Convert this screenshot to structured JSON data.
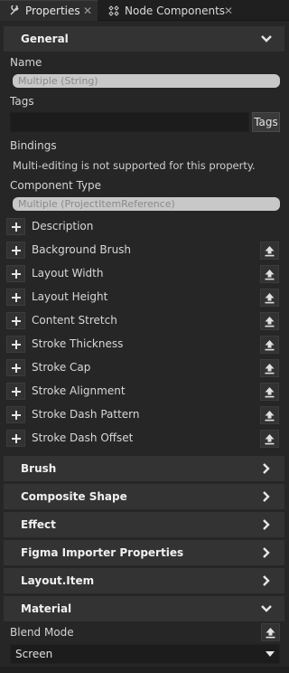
{
  "tabs": [
    {
      "label": "Properties",
      "close": "✕",
      "active": true,
      "icon": "wrench-icon"
    },
    {
      "label": "Node Components",
      "close": "✕",
      "active": false,
      "icon": "components-icon"
    }
  ],
  "general": {
    "header": "General",
    "name_label": "Name",
    "name_value": "Multiple (String)",
    "tags_label": "Tags",
    "tags_value": "",
    "tags_button": "Tags",
    "bindings_label": "Bindings",
    "bindings_note": "Multi-editing is not supported for this property.",
    "component_type_label": "Component Type",
    "component_type_value": "Multiple (ProjectItemReference)"
  },
  "properties": [
    {
      "label": "Description",
      "has_reset": false
    },
    {
      "label": "Background Brush",
      "has_reset": true
    },
    {
      "label": "Layout Width",
      "has_reset": true
    },
    {
      "label": "Layout Height",
      "has_reset": true
    },
    {
      "label": "Content Stretch",
      "has_reset": true
    },
    {
      "label": "Stroke Thickness",
      "has_reset": true
    },
    {
      "label": "Stroke Cap",
      "has_reset": true
    },
    {
      "label": "Stroke Alignment",
      "has_reset": true
    },
    {
      "label": "Stroke Dash Pattern",
      "has_reset": true
    },
    {
      "label": "Stroke Dash Offset",
      "has_reset": true
    }
  ],
  "sections": [
    {
      "label": "Brush",
      "expanded": false
    },
    {
      "label": "Composite Shape",
      "expanded": false
    },
    {
      "label": "Effect",
      "expanded": false
    },
    {
      "label": "Figma Importer Properties",
      "expanded": false
    },
    {
      "label": "Layout.Item",
      "expanded": false
    },
    {
      "label": "Material",
      "expanded": true
    }
  ],
  "material": {
    "blend_mode_label": "Blend Mode",
    "blend_mode_value": "Screen"
  },
  "colors": {
    "background": "#262626",
    "header": "#333333",
    "field_bg": "#c8c8c8",
    "input_bg": "#1c1c1c"
  }
}
